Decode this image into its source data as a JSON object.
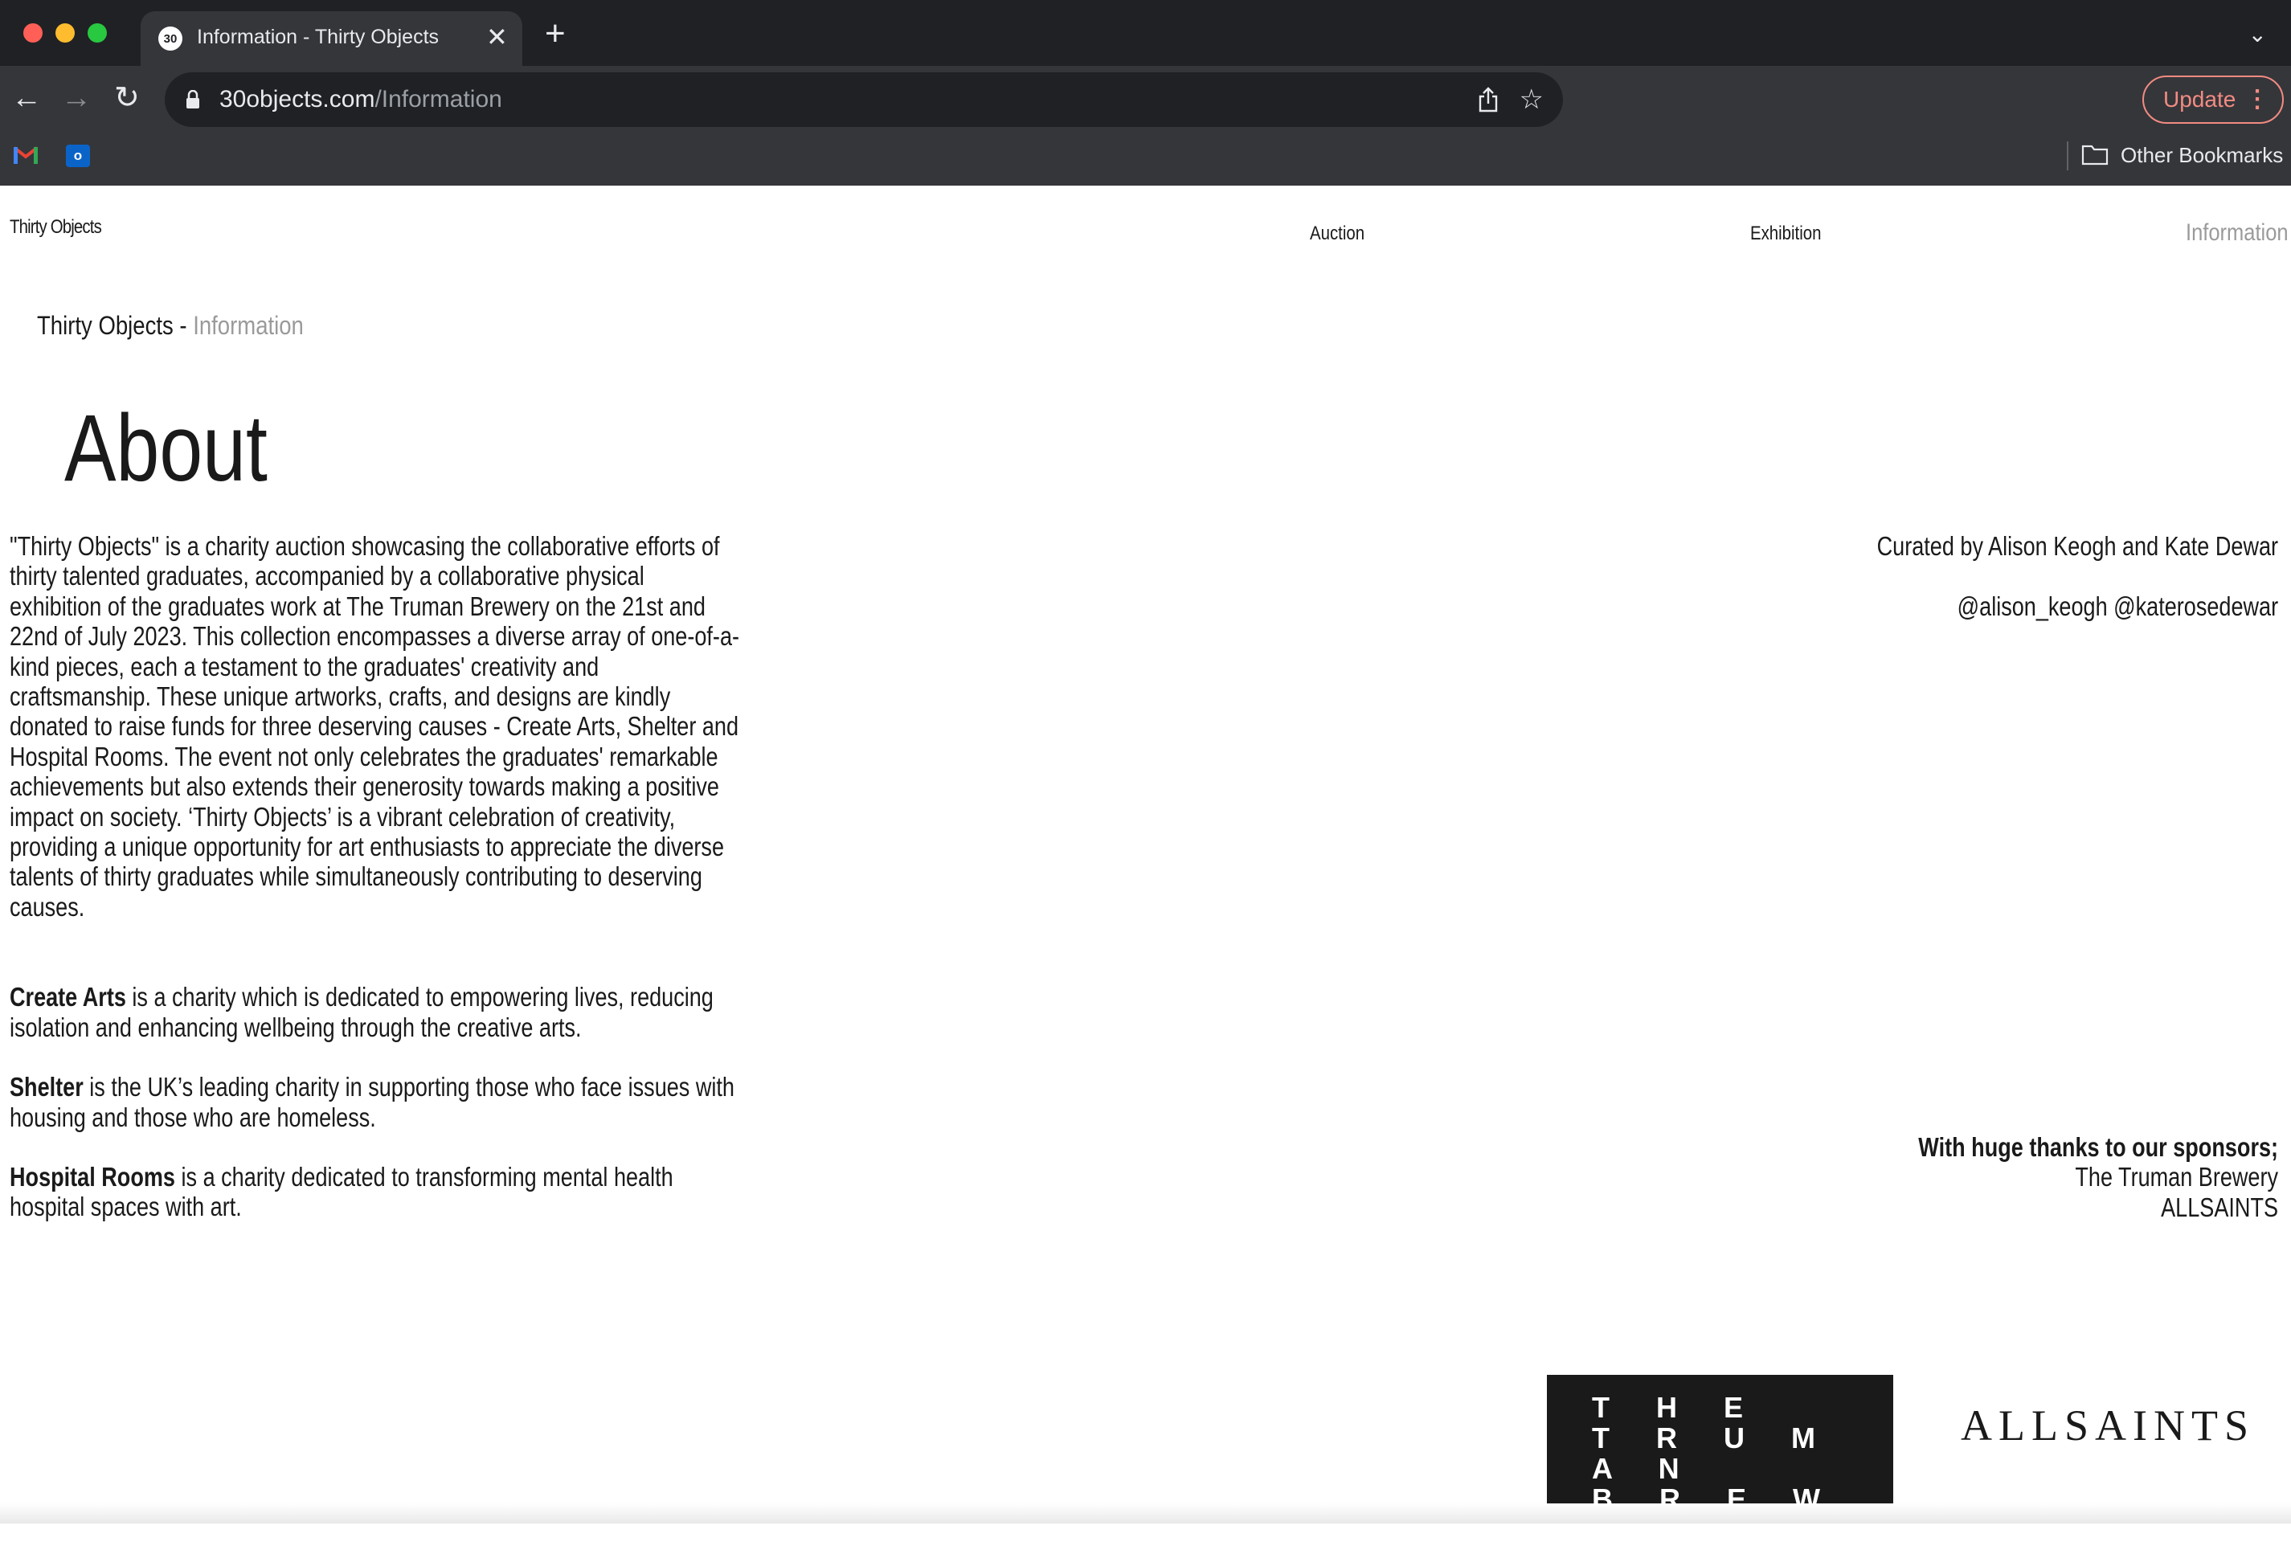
{
  "browser": {
    "tab_title": "Information - Thirty Objects",
    "favicon_text": "30",
    "url_domain": "30objects.com",
    "url_path": "/Information",
    "update_label": "Update",
    "bookmarks": {
      "other_label": "Other Bookmarks",
      "outlook_letter": "o"
    },
    "icons": [
      "close-icon",
      "new-tab-icon",
      "back-icon",
      "forward-icon",
      "reload-icon",
      "lock-icon",
      "share-icon",
      "star-icon",
      "more-icon",
      "gmail-icon",
      "outlook-icon",
      "folder-icon"
    ]
  },
  "site": {
    "name": "Thirty Objects",
    "nav": {
      "auction": "Auction",
      "exhibition": "Exhibition",
      "information": "Information"
    },
    "breadcrumb": {
      "root": "Thirty Objects",
      "separator": "-",
      "current": "Information"
    }
  },
  "about": {
    "title": "About",
    "intro": "\"Thirty Objects\" is a charity auction showcasing the collaborative efforts of thirty talented graduates, accompanied by a collaborative physical exhibition of the graduates work at The Truman Brewery on the 21st and 22nd of July 2023. This collection encompasses a diverse array of one-of-a-kind pieces, each a testament to the graduates' creativity and craftsmanship. These unique artworks, crafts, and designs are kindly donated to raise funds for three deserving causes - Create Arts, Shelter and Hospital Rooms. The event not only celebrates the graduates' remarkable achievements but also extends their generosity towards making a positive impact on society. ‘Thirty Objects’ is a vibrant celebration of creativity, providing a unique opportunity for art enthusiasts to appreciate the diverse talents of thirty graduates while simultaneously contributing to deserving causes.",
    "charities": [
      {
        "name": "Create Arts",
        "text": " is a charity which is dedicated to empowering lives, reducing isolation and enhancing wellbeing through the creative arts."
      },
      {
        "name": "Shelter",
        "text": " is the UK’s leading charity in supporting those who face issues with housing and those who are homeless."
      },
      {
        "name": "Hospital Rooms",
        "text": " is a charity dedicated to transforming mental health hospital spaces with art."
      }
    ],
    "curated": "Curated by Alison Keogh and Kate Dewar",
    "handles": "@alison_keogh @katerosedewar",
    "sponsors_heading": "With huge thanks to our sponsors;",
    "sponsors": [
      "The Truman Brewery",
      "ALLSAINTS"
    ],
    "logos": {
      "truman": [
        "T H E",
        "T R U M A N",
        "B R E W E R Y"
      ],
      "allsaints": "ALLSAINTS"
    }
  }
}
